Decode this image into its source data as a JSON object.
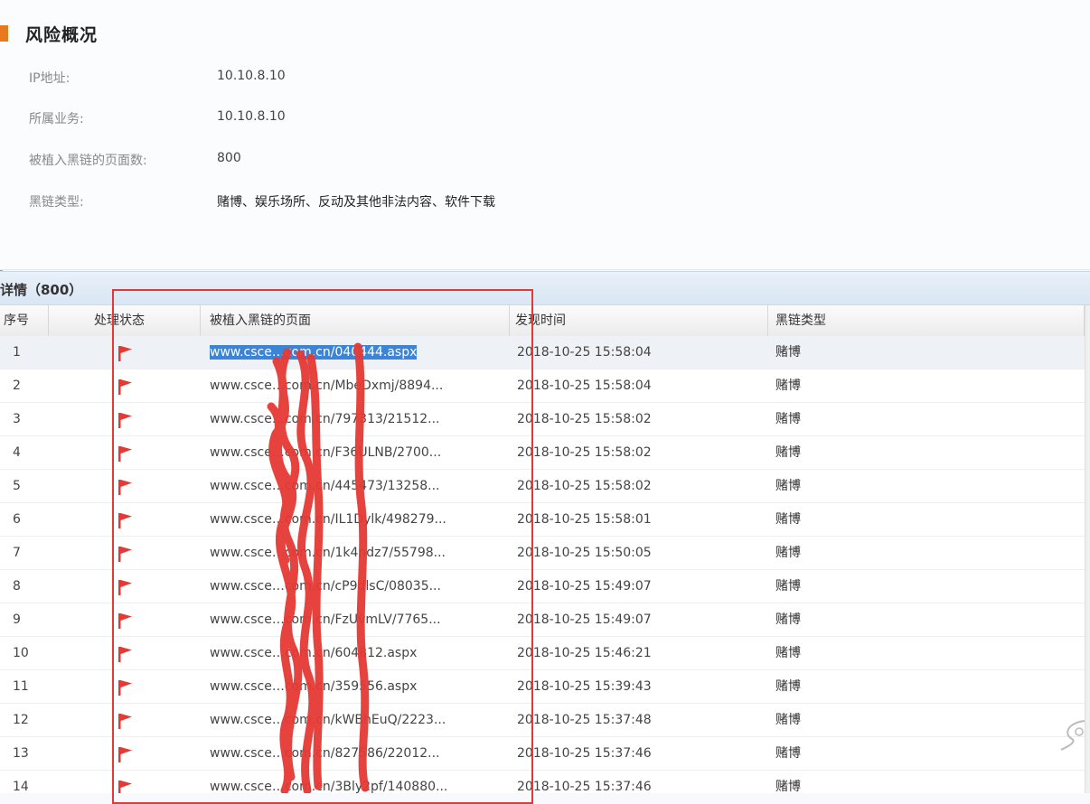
{
  "overview": {
    "title": "风险概况",
    "fields": [
      {
        "label": "IP地址:",
        "value": "10.10.8.10"
      },
      {
        "label": "所属业务:",
        "value": "10.10.8.10"
      },
      {
        "label": "被植入黑链的页面数:",
        "value": "800"
      },
      {
        "label": "黑链类型:",
        "value": "赌博、娱乐场所、反动及其他非法内容、软件下载"
      }
    ]
  },
  "details": {
    "title": "详情（800）",
    "columns": [
      "序号",
      "处理状态",
      "被植入黑链的页面",
      "发现时间",
      "黑链类型"
    ],
    "rows": [
      {
        "index": "1",
        "url": "www.csce…com.cn/040444.aspx",
        "time": "2018-10-25 15:58:04",
        "type": "赌博"
      },
      {
        "index": "2",
        "url": "www.csce…com.cn/MbeDxmj/8894...",
        "time": "2018-10-25 15:58:04",
        "type": "赌博"
      },
      {
        "index": "3",
        "url": "www.csce…com.cn/797313/21512...",
        "time": "2018-10-25 15:58:02",
        "type": "赌博"
      },
      {
        "index": "4",
        "url": "www.csce…com.cn/F36ULNB/2700...",
        "time": "2018-10-25 15:58:02",
        "type": "赌博"
      },
      {
        "index": "5",
        "url": "www.csce…com.cn/445473/13258...",
        "time": "2018-10-25 15:58:02",
        "type": "赌博"
      },
      {
        "index": "6",
        "url": "www.csce…com.cn/IL1Dylk/498279...",
        "time": "2018-10-25 15:58:01",
        "type": "赌博"
      },
      {
        "index": "7",
        "url": "www.csce…com.cn/1k4ndz7/55798...",
        "time": "2018-10-25 15:50:05",
        "type": "赌博"
      },
      {
        "index": "8",
        "url": "www.csce…com.cn/cP9dlsC/08035...",
        "time": "2018-10-25 15:49:07",
        "type": "赌博"
      },
      {
        "index": "9",
        "url": "www.csce…com.cn/FzUvmLV/7765...",
        "time": "2018-10-25 15:49:07",
        "type": "赌博"
      },
      {
        "index": "10",
        "url": "www.csce…com.cn/604812.aspx",
        "time": "2018-10-25 15:46:21",
        "type": "赌博"
      },
      {
        "index": "11",
        "url": "www.csce…com.cn/359556.aspx",
        "time": "2018-10-25 15:39:43",
        "type": "赌博"
      },
      {
        "index": "12",
        "url": "www.csce…com.cn/kWBhEuQ/2223...",
        "time": "2018-10-25 15:37:48",
        "type": "赌博"
      },
      {
        "index": "13",
        "url": "www.csce…com.cn/827586/22012...",
        "time": "2018-10-25 15:37:46",
        "type": "赌博"
      },
      {
        "index": "14",
        "url": "www.csce…com.cn/3Bly2pf/140880...",
        "time": "2018-10-25 15:37:46",
        "type": "赌博"
      }
    ]
  },
  "colors": {
    "accent": "#e8791d",
    "flag": "#e53935",
    "redaction": "#e53935",
    "selection": "#3b84d6"
  },
  "icons": {
    "status_flag": "red-flag-icon"
  }
}
